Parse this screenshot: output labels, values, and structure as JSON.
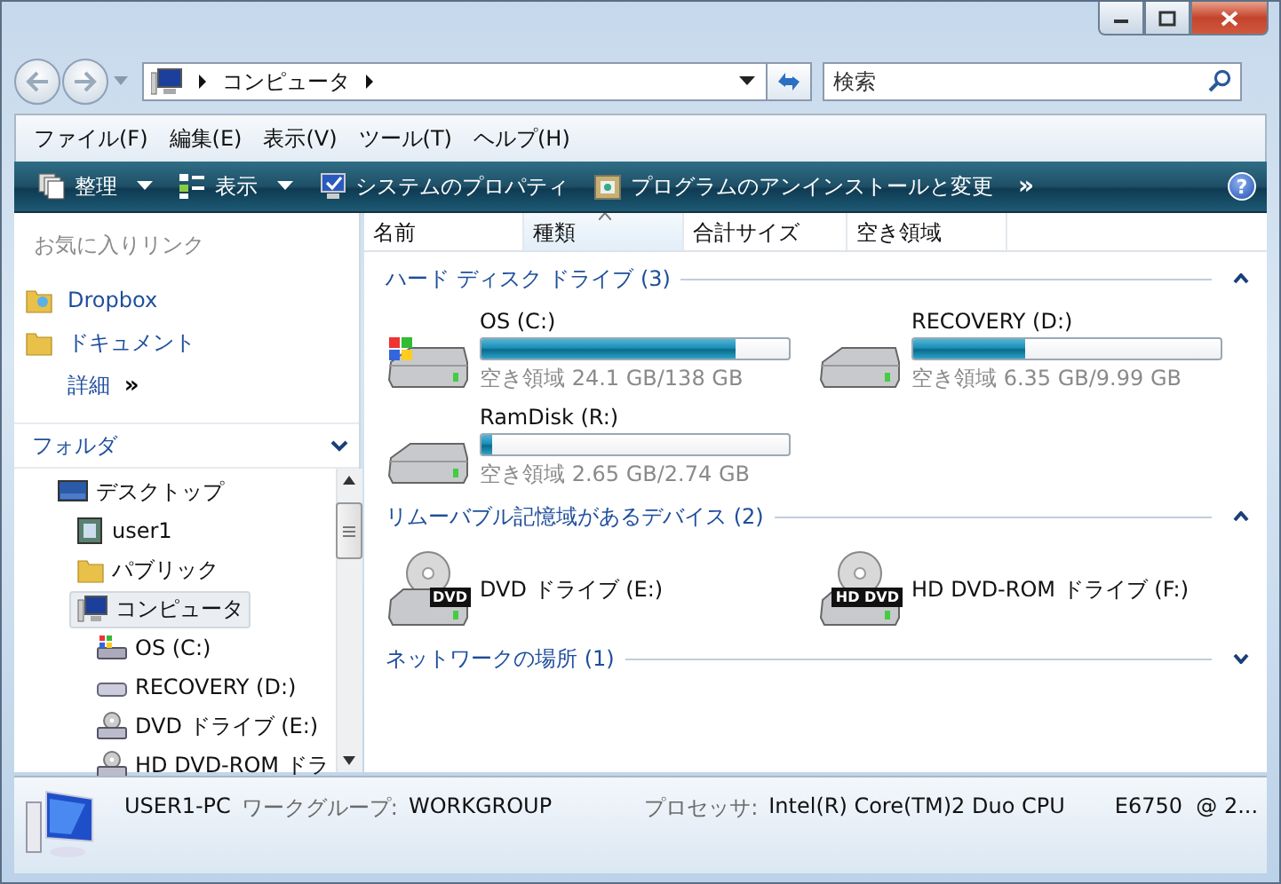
{
  "address": {
    "path": [
      "コンピュータ"
    ],
    "search_placeholder": "検索"
  },
  "menu": [
    "ファイル(F)",
    "編集(E)",
    "表示(V)",
    "ツール(T)",
    "ヘルプ(H)"
  ],
  "toolbar": {
    "items": [
      {
        "label": "整理",
        "kind": "organize",
        "dropdown": true
      },
      {
        "label": "表示",
        "kind": "views",
        "dropdown": true
      },
      {
        "label": "システムのプロパティ",
        "kind": "system",
        "dropdown": false
      },
      {
        "label": "プログラムのアンインストールと変更",
        "kind": "programs",
        "dropdown": false
      }
    ],
    "more": "»",
    "help": "?"
  },
  "favorites": {
    "title": "お気に入りリンク",
    "items": [
      {
        "label": "Dropbox",
        "kind": "dropbox"
      },
      {
        "label": "ドキュメント",
        "kind": "folder"
      }
    ],
    "more": {
      "label": "詳細",
      "arrow": "»"
    }
  },
  "folders": {
    "title": "フォルダ",
    "expanded": true,
    "tree": [
      {
        "label": "デスクトップ",
        "kind": "desktop",
        "selected": false,
        "children": [
          {
            "label": "user1",
            "kind": "user",
            "selected": false
          },
          {
            "label": "パブリック",
            "kind": "folder",
            "selected": false
          },
          {
            "label": "コンピュータ",
            "kind": "computer",
            "selected": true,
            "children": [
              {
                "label": "OS (C:)",
                "kind": "systemdisk",
                "selected": false
              },
              {
                "label": "RECOVERY (D:)",
                "kind": "disk",
                "selected": false
              },
              {
                "label": "DVD ドライブ (E:)",
                "kind": "optical",
                "selected": false
              },
              {
                "label": "HD DVD-ROM ドラ",
                "kind": "optical",
                "selected": false
              }
            ]
          }
        ]
      }
    ]
  },
  "columns": [
    {
      "label": "名前",
      "sorted": false
    },
    {
      "label": "種類",
      "sorted": true
    },
    {
      "label": "合計サイズ",
      "sorted": false
    },
    {
      "label": "空き領域",
      "sorted": false
    }
  ],
  "groups": [
    {
      "title": "ハード ディスク ドライブ (3)",
      "expanded": true,
      "items": [
        {
          "kind": "systemdisk",
          "name": "OS (C:)",
          "level": 0.825,
          "free": "空き領域 24.1 GB/138 GB"
        },
        {
          "kind": "disk",
          "name": "RECOVERY (D:)",
          "level": 0.364,
          "free": "空き領域 6.35 GB/9.99 GB"
        },
        {
          "kind": "disk",
          "name": "RamDisk (R:)",
          "level": 0.033,
          "free": "空き領域 2.65 GB/2.74 GB"
        }
      ]
    },
    {
      "title": "リムーバブル記憶域があるデバイス (2)",
      "expanded": true,
      "items": [
        {
          "kind": "optical",
          "badge": "DVD",
          "name": "DVD ドライブ (E:)"
        },
        {
          "kind": "optical",
          "badge": "HD DVD",
          "name": "HD DVD-ROM ドライブ (F:)"
        }
      ]
    },
    {
      "title": "ネットワークの場所 (1)",
      "expanded": false
    }
  ],
  "status": {
    "computer": "USER1-PC",
    "workgroup_label": "ワークグループ:",
    "workgroup": "WORKGROUP",
    "processor_label": "プロセッサ:",
    "processor": "Intel(R) Core(TM)2 Duo CPU",
    "processor_more": "E6750  @ 2..."
  }
}
